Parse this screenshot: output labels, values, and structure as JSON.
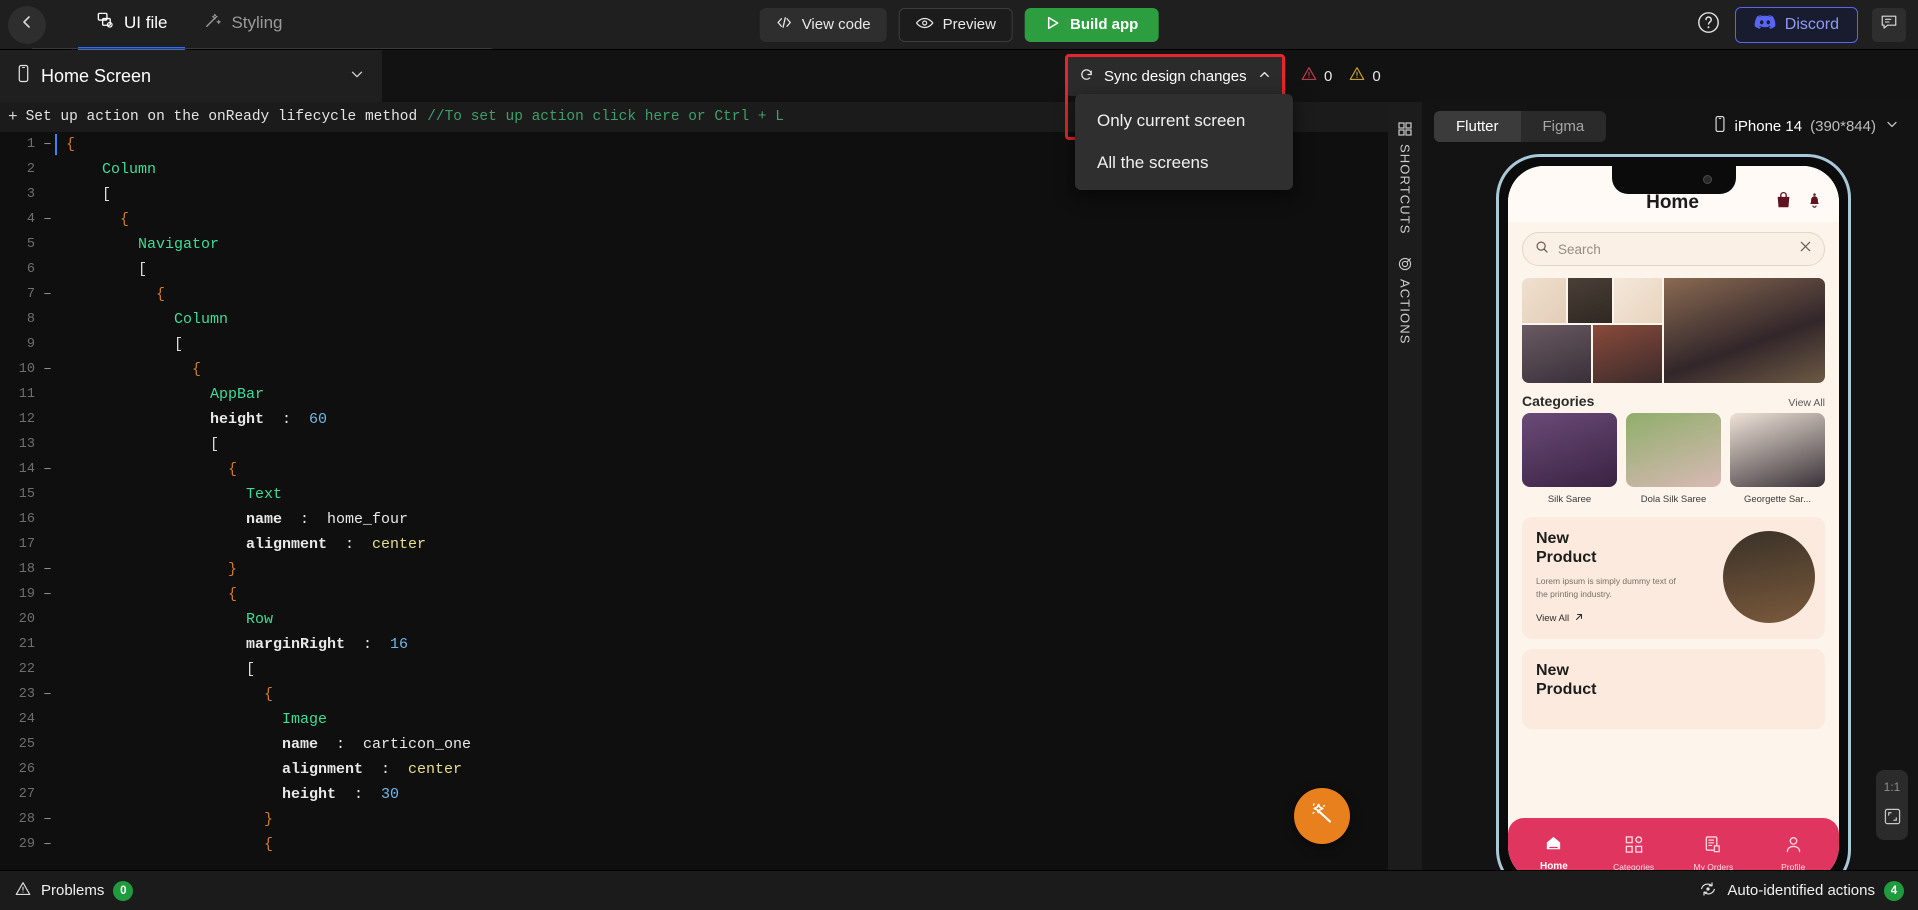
{
  "topbar": {
    "back_icon": "chevron-left-icon",
    "tabs": [
      {
        "label": "UI file",
        "icon": "ui-file-icon",
        "active": true
      },
      {
        "label": "Styling",
        "icon": "magic-wand-icon",
        "active": false
      }
    ],
    "view_code_label": "View code",
    "preview_label": "Preview",
    "build_app_label": "Build app",
    "help_icon": "help-circle-icon",
    "discord_label": "Discord",
    "feedback_icon": "feedback-icon"
  },
  "screenrow": {
    "screen_name": "Home Screen",
    "screen_icon": "mobile-icon",
    "chevron_icon": "chevron-down-icon",
    "sync": {
      "label": "Sync design changes",
      "icon": "sync-icon",
      "chevron": "chevron-up-icon",
      "menu": [
        {
          "label": "Only current screen"
        },
        {
          "label": "All the screens"
        }
      ]
    },
    "errors_count": "0",
    "warnings_count": "0",
    "error_color": "#c0394b",
    "warning_color": "#c8a02a"
  },
  "editor": {
    "lifecycle_text": "Set up action on the onReady lifecycle method",
    "lifecycle_comment": "//To set up action click here or Ctrl + L",
    "magic_fab_icon": "magic-wand-icon",
    "lines": [
      {
        "n": "1",
        "fold": "−",
        "indent": 0,
        "tokens": [
          {
            "t": "{",
            "c": "k-brace"
          }
        ]
      },
      {
        "n": "2",
        "fold": "",
        "indent": 2,
        "tokens": [
          {
            "t": "Column",
            "c": "k-type"
          }
        ]
      },
      {
        "n": "3",
        "fold": "",
        "indent": 2,
        "tokens": [
          {
            "t": "[",
            "c": "k-brk"
          }
        ]
      },
      {
        "n": "4",
        "fold": "−",
        "indent": 3,
        "tokens": [
          {
            "t": "{",
            "c": "k-brace"
          }
        ]
      },
      {
        "n": "5",
        "fold": "",
        "indent": 4,
        "tokens": [
          {
            "t": "Navigator",
            "c": "k-type"
          }
        ]
      },
      {
        "n": "6",
        "fold": "",
        "indent": 4,
        "tokens": [
          {
            "t": "[",
            "c": "k-brk"
          }
        ]
      },
      {
        "n": "7",
        "fold": "−",
        "indent": 5,
        "tokens": [
          {
            "t": "{",
            "c": "k-brace"
          }
        ]
      },
      {
        "n": "8",
        "fold": "",
        "indent": 6,
        "tokens": [
          {
            "t": "Column",
            "c": "k-type"
          }
        ]
      },
      {
        "n": "9",
        "fold": "",
        "indent": 6,
        "tokens": [
          {
            "t": "[",
            "c": "k-brk"
          }
        ]
      },
      {
        "n": "10",
        "fold": "−",
        "indent": 7,
        "tokens": [
          {
            "t": "{",
            "c": "k-brace"
          }
        ]
      },
      {
        "n": "11",
        "fold": "",
        "indent": 8,
        "tokens": [
          {
            "t": "AppBar",
            "c": "k-type"
          }
        ]
      },
      {
        "n": "12",
        "fold": "",
        "indent": 8,
        "tokens": [
          {
            "t": "height",
            "c": "k-prop"
          },
          {
            "t": "  :  ",
            "c": "k-val"
          },
          {
            "t": "60",
            "c": "k-num"
          }
        ]
      },
      {
        "n": "13",
        "fold": "",
        "indent": 8,
        "tokens": [
          {
            "t": "[",
            "c": "k-brk"
          }
        ]
      },
      {
        "n": "14",
        "fold": "−",
        "indent": 9,
        "tokens": [
          {
            "t": "{",
            "c": "k-brace"
          }
        ]
      },
      {
        "n": "15",
        "fold": "",
        "indent": 10,
        "tokens": [
          {
            "t": "Text",
            "c": "k-type"
          }
        ]
      },
      {
        "n": "16",
        "fold": "",
        "indent": 10,
        "tokens": [
          {
            "t": "name",
            "c": "k-prop"
          },
          {
            "t": "  :  ",
            "c": "k-val"
          },
          {
            "t": "home_four",
            "c": "k-val"
          }
        ]
      },
      {
        "n": "17",
        "fold": "",
        "indent": 10,
        "tokens": [
          {
            "t": "alignment",
            "c": "k-prop"
          },
          {
            "t": "  :  ",
            "c": "k-val"
          },
          {
            "t": "center",
            "c": "k-str"
          }
        ]
      },
      {
        "n": "18",
        "fold": "−",
        "indent": 9,
        "tokens": [
          {
            "t": "}",
            "c": "k-brace"
          }
        ]
      },
      {
        "n": "19",
        "fold": "−",
        "indent": 9,
        "tokens": [
          {
            "t": "{",
            "c": "k-brace"
          }
        ]
      },
      {
        "n": "20",
        "fold": "",
        "indent": 10,
        "tokens": [
          {
            "t": "Row",
            "c": "k-type"
          }
        ]
      },
      {
        "n": "21",
        "fold": "",
        "indent": 10,
        "tokens": [
          {
            "t": "marginRight",
            "c": "k-prop"
          },
          {
            "t": "  :  ",
            "c": "k-val"
          },
          {
            "t": "16",
            "c": "k-num"
          }
        ]
      },
      {
        "n": "22",
        "fold": "",
        "indent": 10,
        "tokens": [
          {
            "t": "[",
            "c": "k-brk"
          }
        ]
      },
      {
        "n": "23",
        "fold": "−",
        "indent": 11,
        "tokens": [
          {
            "t": "{",
            "c": "k-brace"
          }
        ]
      },
      {
        "n": "24",
        "fold": "",
        "indent": 12,
        "tokens": [
          {
            "t": "Image",
            "c": "k-type"
          }
        ]
      },
      {
        "n": "25",
        "fold": "",
        "indent": 12,
        "tokens": [
          {
            "t": "name",
            "c": "k-prop"
          },
          {
            "t": "  :  ",
            "c": "k-val"
          },
          {
            "t": "carticon_one",
            "c": "k-val"
          }
        ]
      },
      {
        "n": "26",
        "fold": "",
        "indent": 12,
        "tokens": [
          {
            "t": "alignment",
            "c": "k-prop"
          },
          {
            "t": "  :  ",
            "c": "k-val"
          },
          {
            "t": "center",
            "c": "k-str"
          }
        ]
      },
      {
        "n": "27",
        "fold": "",
        "indent": 12,
        "tokens": [
          {
            "t": "height",
            "c": "k-prop"
          },
          {
            "t": "  :  ",
            "c": "k-val"
          },
          {
            "t": "30",
            "c": "k-num"
          }
        ]
      },
      {
        "n": "28",
        "fold": "−",
        "indent": 11,
        "tokens": [
          {
            "t": "}",
            "c": "k-brace"
          }
        ]
      },
      {
        "n": "29",
        "fold": "−",
        "indent": 11,
        "tokens": [
          {
            "t": "{",
            "c": "k-brace"
          }
        ]
      }
    ]
  },
  "vstrip": [
    {
      "label": "SHORTCUTS",
      "icon": "grid-icon"
    },
    {
      "label": "ACTIONS",
      "icon": "target-icon"
    }
  ],
  "preview": {
    "segments": [
      {
        "label": "Flutter",
        "active": true
      },
      {
        "label": "Figma",
        "active": false
      }
    ],
    "device_icon": "mobile-icon",
    "device_name": "iPhone 14",
    "device_dims": "(390*844)",
    "device_chevron": "chevron-down-icon",
    "zoom_label": "1:1",
    "fit_icon": "fit-screen-icon"
  },
  "app": {
    "title": "Home",
    "bag_icon": "shopping-bag-icon",
    "bell_icon": "bell-icon",
    "search_placeholder": "Search",
    "search_icon": "search-icon",
    "clear_icon": "close-icon",
    "categories_title": "Categories",
    "view_all_label": "View All",
    "categories": [
      {
        "name": "Silk Saree"
      },
      {
        "name": "Dola Silk Saree"
      },
      {
        "name": "Georgette Sar..."
      }
    ],
    "promo": {
      "title_line1": "New",
      "title_line2": "Product",
      "subtitle": "Lorem ipsum is simply dummy text of the printing industry.",
      "link": "View All",
      "link_icon": "arrow-up-right-icon"
    },
    "promo2": {
      "title_line1": "New",
      "title_line2": "Product"
    },
    "nav": [
      {
        "label": "Home",
        "icon": "home-icon",
        "active": true
      },
      {
        "label": "Categories",
        "icon": "grid-icon",
        "active": false
      },
      {
        "label": "My Orders",
        "icon": "orders-icon",
        "active": false
      },
      {
        "label": "Profile",
        "icon": "person-icon",
        "active": false
      }
    ],
    "accent_color": "#e0355f"
  },
  "bottombar": {
    "problems_label": "Problems",
    "problems_icon": "warning-triangle-icon",
    "problems_count": "0",
    "auto_label": "Auto-identified actions",
    "auto_icon": "auto-detect-icon",
    "auto_count": "4",
    "badge_color": "#1f9a3d"
  }
}
